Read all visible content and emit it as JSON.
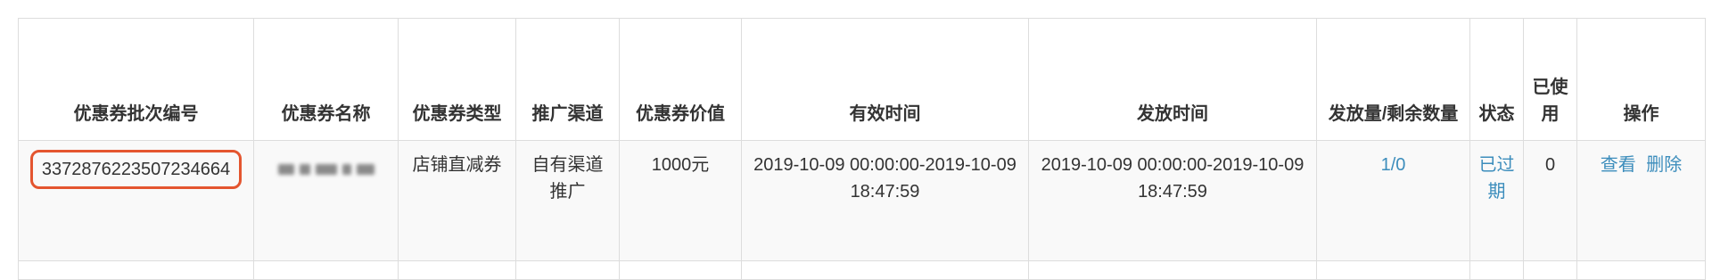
{
  "headers": {
    "batch_no": "优惠券批次编号",
    "name": "优惠券名称",
    "type": "优惠券类型",
    "channel": "推广渠道",
    "value": "优惠券价值",
    "valid_time": "有效时间",
    "issue_time": "发放时间",
    "issued_remaining": "发放量/剩余数量",
    "status": "状态",
    "used": "已使用",
    "actions": "操作"
  },
  "row": {
    "batch_no": "3372876223507234664",
    "type": "店铺直减券",
    "channel": "自有渠道推广",
    "value": "1000元",
    "valid_time": "2019-10-09 00:00:00-2019-10-09 18:47:59",
    "issue_time": "2019-10-09 00:00:00-2019-10-09 18:47:59",
    "issued_remaining": "1/0",
    "status": "已过期",
    "used": "0",
    "action_view": "查看",
    "action_delete": "删除"
  },
  "colors": {
    "highlight_border": "#e4552f",
    "link": "#3c8dbc",
    "border": "#dddddd"
  }
}
